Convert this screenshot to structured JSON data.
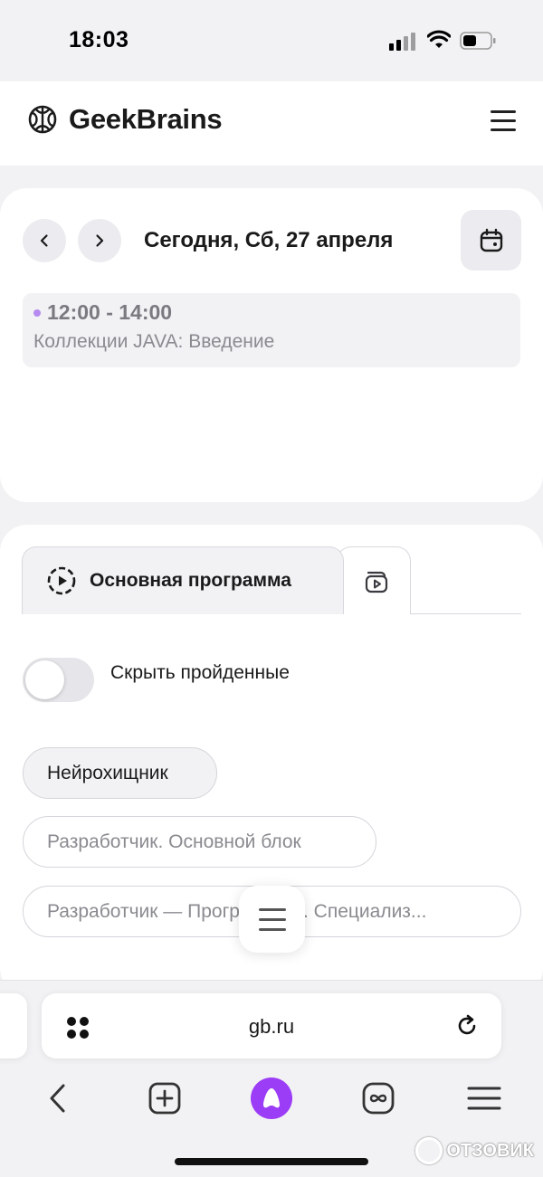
{
  "status": {
    "time": "18:03"
  },
  "header": {
    "brand": "GeekBrains"
  },
  "calendar": {
    "title": "Сегодня, Сб, 27 апреля",
    "event": {
      "time": "12:00 - 14:00",
      "title": "Коллекции JAVA: Введение",
      "dot_color": "#b68af0"
    }
  },
  "program": {
    "tabs": [
      {
        "label": "Основная программа"
      }
    ],
    "toggle_label": "Скрыть пройденные",
    "toggle_on": false,
    "chips": [
      {
        "label": "Нейрохищник"
      },
      {
        "label": "Разработчик. Основной блок"
      },
      {
        "label": "Разработчик — Программист. Специализ..."
      }
    ]
  },
  "browser": {
    "url": "gb.ru",
    "alice_color": "#9b3cf6"
  },
  "watermark": "ОТЗОВИК"
}
